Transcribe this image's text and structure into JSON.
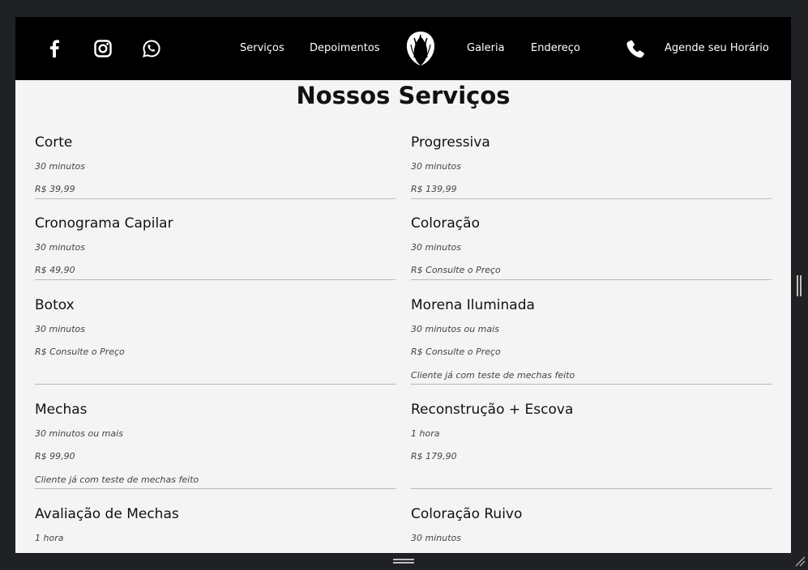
{
  "nav": {
    "left": "Serviços",
    "left2": "Depoimentos",
    "right": "Galeria",
    "right2": "Endereço",
    "cta": "Agende seu Horário"
  },
  "icons": {
    "facebook": "facebook-icon",
    "instagram": "instagram-icon",
    "whatsapp": "whatsapp-icon",
    "logo": "hair-logo-icon",
    "phone": "phone-icon"
  },
  "page_title": "Nossos Serviços",
  "services": [
    {
      "name": "Corte",
      "lines": [
        "30 minutos",
        "R$ 39,99"
      ]
    },
    {
      "name": "Progressiva",
      "lines": [
        "30 minutos",
        "R$ 139,99"
      ]
    },
    {
      "name": "Cronograma Capilar",
      "lines": [
        "30 minutos",
        "R$ 49,90"
      ]
    },
    {
      "name": "Coloração",
      "lines": [
        "30 minutos",
        "R$ Consulte o Preço"
      ]
    },
    {
      "name": "Botox",
      "lines": [
        "30 minutos",
        "R$ Consulte o Preço"
      ]
    },
    {
      "name": "Morena Iluminada",
      "lines": [
        "30 minutos ou mais",
        "R$ Consulte o Preço",
        "Cliente já com teste de mechas feito"
      ]
    },
    {
      "name": "Mechas",
      "lines": [
        "30 minutos ou mais",
        "R$ 99,90",
        "Cliente já com teste de mechas feito"
      ]
    },
    {
      "name": "Reconstrução + Escova",
      "lines": [
        "1 hora",
        "R$ 179,90"
      ]
    },
    {
      "name": "Avaliação de Mechas",
      "lines": [
        "1 hora"
      ]
    },
    {
      "name": "Coloração Ruivo",
      "lines": [
        "30 minutos"
      ]
    }
  ],
  "colors": {
    "header_bg": "#000000",
    "page_bg": "#f4f4f4",
    "chrome_bg": "#202124"
  }
}
